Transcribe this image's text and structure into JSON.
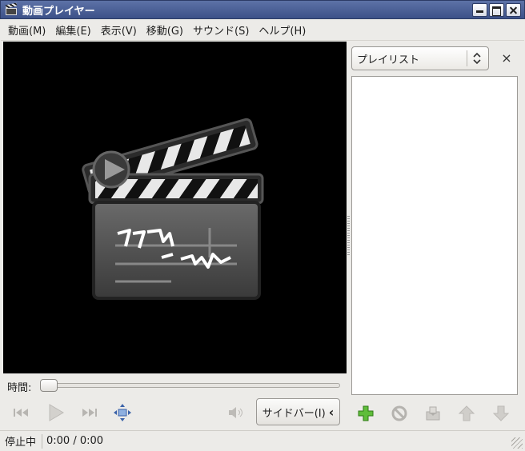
{
  "window": {
    "title": "動画プレイヤー"
  },
  "menu": {
    "items": [
      {
        "label": "動画(M)"
      },
      {
        "label": "編集(E)"
      },
      {
        "label": "表示(V)"
      },
      {
        "label": "移動(G)"
      },
      {
        "label": "サウンド(S)"
      },
      {
        "label": "ヘルプ(H)"
      }
    ]
  },
  "seek": {
    "label": "時間:",
    "position_fraction": 0
  },
  "controls": {
    "previous_icon": "skip-previous-icon",
    "play_icon": "play-icon",
    "next_icon": "skip-next-icon",
    "fullscreen_icon": "fullscreen-icon",
    "volume_icon": "volume-icon",
    "sidebar_button_label": "サイドバー(I)",
    "sidebar_chevron": "‹"
  },
  "sidebar": {
    "selector_value": "プレイリスト",
    "close_glyph": "×",
    "toolbar_icons": [
      "add-icon",
      "remove-icon",
      "save-icon",
      "move-up-icon",
      "move-down-icon"
    ]
  },
  "status": {
    "state": "停止中",
    "time": "0:00 / 0:00"
  },
  "colors": {
    "titlebar": "#4a5f96",
    "video_bg": "#000000",
    "add_green": "#4caf2a"
  }
}
